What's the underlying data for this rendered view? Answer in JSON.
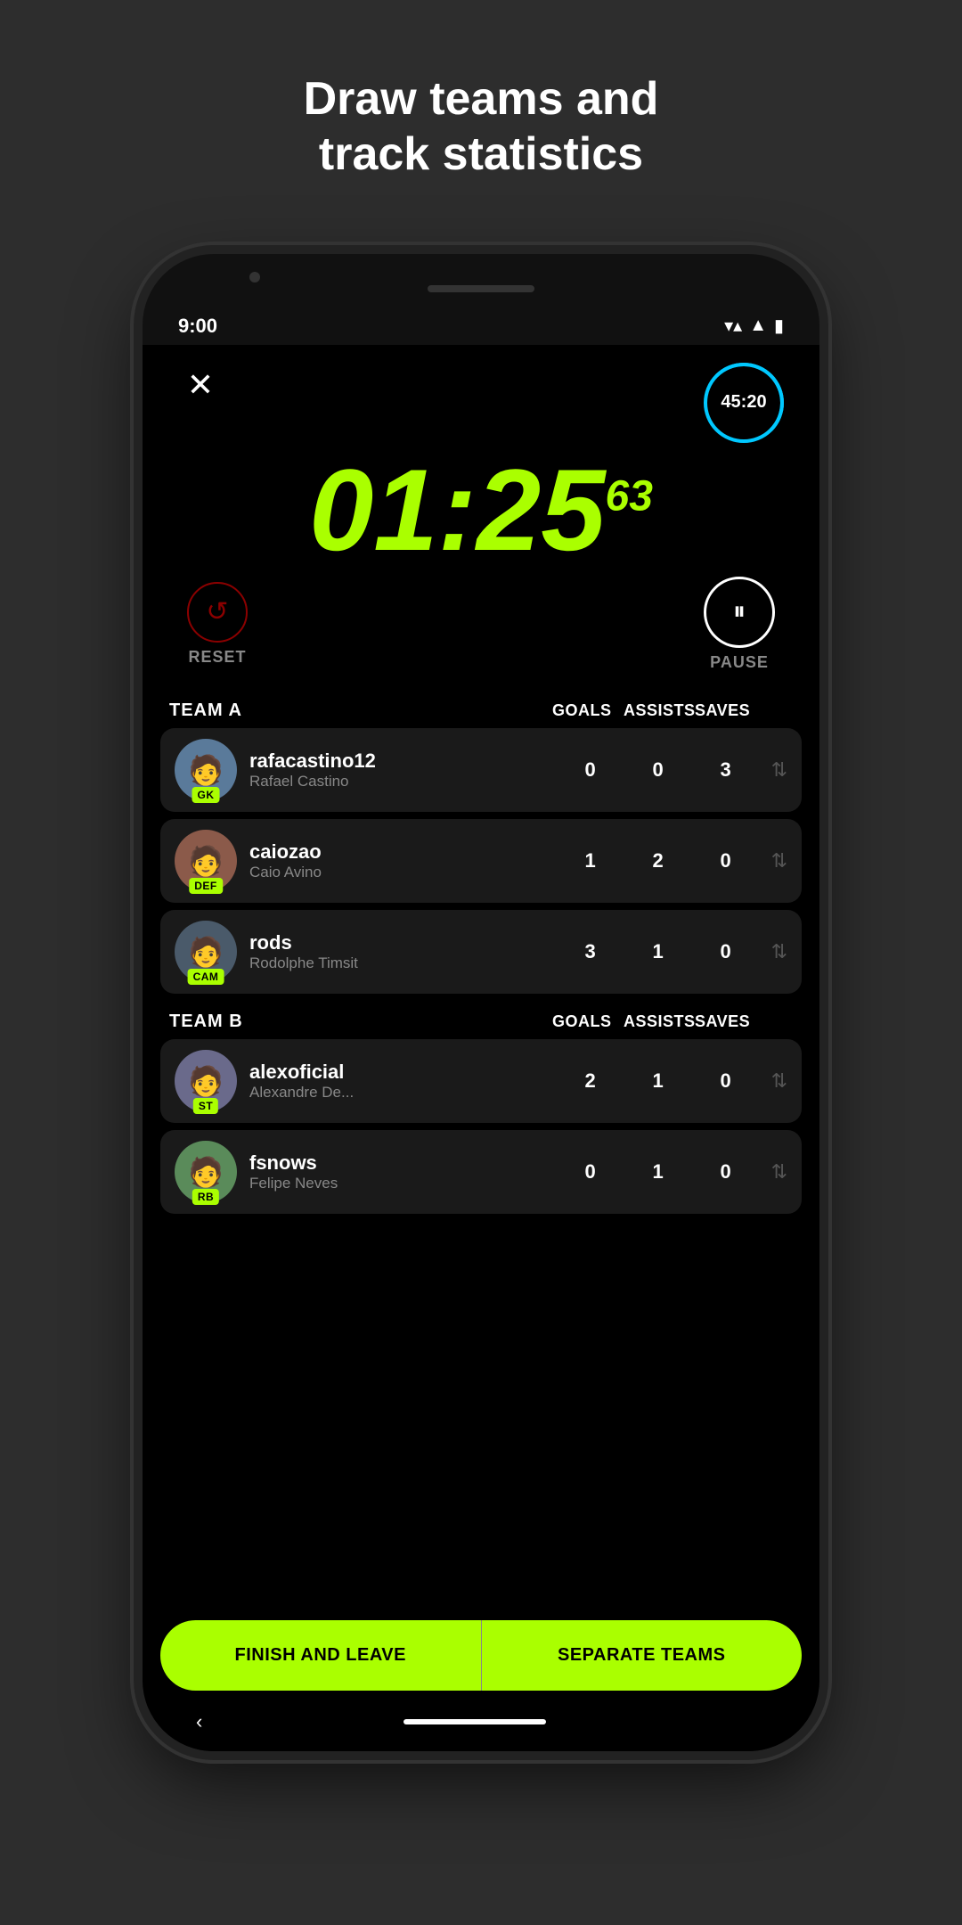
{
  "header": {
    "title": "Draw teams and\ntrack statistics"
  },
  "status_bar": {
    "time": "9:00",
    "wifi": "▼",
    "signal": "▲",
    "battery": "🔋"
  },
  "timer_circle": {
    "label": "45:20"
  },
  "main_timer": {
    "time": "01:25",
    "milliseconds": "63"
  },
  "controls": {
    "reset_label": "RESET",
    "pause_label": "PAUSE"
  },
  "team_a": {
    "name": "TEAM A",
    "stats_header": [
      "GOALS",
      "ASSISTS",
      "SAVES"
    ],
    "players": [
      {
        "username": "rafacastino12",
        "fullname": "Rafael Castino",
        "position": "GK",
        "goals": "0",
        "assists": "0",
        "saves": "3",
        "avatar_emoji": "👤",
        "avatar_color": "#5a7a9a"
      },
      {
        "username": "caiozao",
        "fullname": "Caio Avino",
        "position": "DEF",
        "goals": "1",
        "assists": "2",
        "saves": "0",
        "avatar_emoji": "👤",
        "avatar_color": "#8b5a4a"
      },
      {
        "username": "rods",
        "fullname": "Rodolphe Timsit",
        "position": "CAM",
        "goals": "3",
        "assists": "1",
        "saves": "0",
        "avatar_emoji": "👤",
        "avatar_color": "#4a5a6a"
      }
    ]
  },
  "team_b": {
    "name": "TEAM B",
    "stats_header": [
      "GOALS",
      "ASSISTS",
      "SAVES"
    ],
    "players": [
      {
        "username": "alexoficial",
        "fullname": "Alexandre De...",
        "position": "ST",
        "goals": "2",
        "assists": "1",
        "saves": "0",
        "avatar_emoji": "👤",
        "avatar_color": "#6a6a8b"
      },
      {
        "username": "fsnows",
        "fullname": "Felipe Neves",
        "position": "RB",
        "goals": "0",
        "assists": "1",
        "saves": "0",
        "avatar_emoji": "👤",
        "avatar_color": "#5a8b5a"
      }
    ]
  },
  "buttons": {
    "finish_label": "FINISH AND LEAVE",
    "separate_label": "SEPARATE TEAMS"
  },
  "nav": {
    "back_arrow": "‹"
  }
}
